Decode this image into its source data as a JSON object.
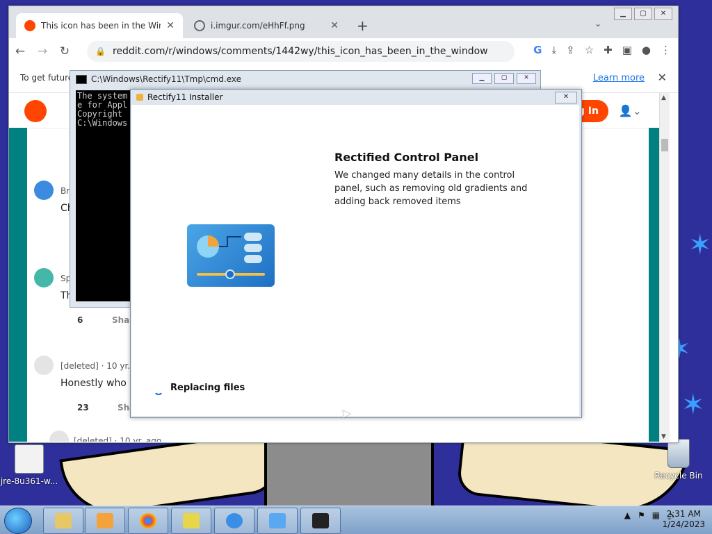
{
  "browser": {
    "tabs": [
      {
        "label": "This icon has been in the Window"
      },
      {
        "label": "i.imgur.com/eHhFf.png"
      }
    ],
    "url": "reddit.com/r/windows/comments/1442wy/this_icon_has_been_in_the_windows_folder_...",
    "infobar": {
      "message": "To get future",
      "learn_more": "Learn more"
    },
    "login_label": "Log In",
    "comments": [
      {
        "author": "Br",
        "body": "Ch"
      },
      {
        "author": "Sp",
        "body": "Th",
        "votes": "6",
        "share": "Shar"
      },
      {
        "author": "[deleted]",
        "meta": "· 10 yr. a",
        "body": "Honestly who c",
        "votes": "23",
        "share": "Sha"
      },
      {
        "author": "[deleted]",
        "meta": "· 10 yr. ago"
      }
    ]
  },
  "cmd": {
    "title": "C:\\Windows\\Rectify11\\Tmp\\cmd.exe",
    "lines": [
      "The system",
      "e for Appl",
      "",
      "Copyright",
      "",
      "C:\\Windows"
    ]
  },
  "installer": {
    "title": "Rectify11 Installer",
    "heading": "Rectified Control Panel",
    "description": "We changed many details in the control panel, such as removing old gradients and adding back removed items",
    "status": "Replacing files"
  },
  "desktop": {
    "icons": [
      {
        "label": "jre-8u361-w..."
      },
      {
        "label": "Recycle Bin"
      }
    ]
  },
  "taskbar": {
    "time": "2:31 AM",
    "date": "1/24/2023"
  }
}
